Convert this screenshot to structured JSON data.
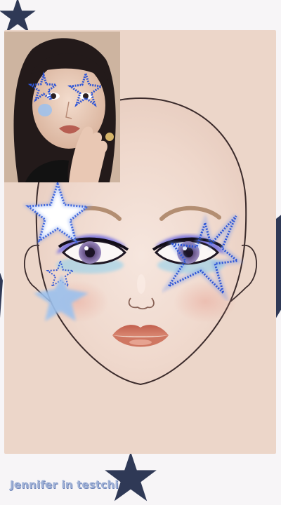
{
  "caption": "Jennifer in testchi",
  "colors": {
    "card_background": "#ecd6c9",
    "star_outline": "#2e55d6",
    "star_fill": "#9bc1ee",
    "eyeshadow": "#6f6ae0",
    "lips": "#c9705c",
    "background_stars": "#2f3956"
  },
  "icons": [
    "star-icon",
    "face-chart",
    "reference-photo"
  ]
}
